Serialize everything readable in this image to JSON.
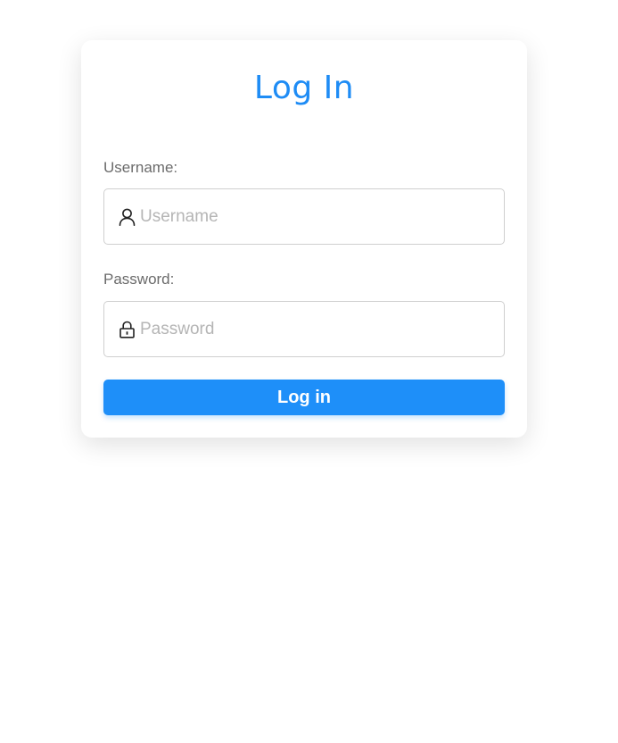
{
  "form": {
    "title": "Log In",
    "username": {
      "label": "Username:",
      "placeholder": "Username",
      "value": "",
      "icon": "user-icon"
    },
    "password": {
      "label": "Password:",
      "placeholder": "Password",
      "value": "",
      "icon": "lock-icon"
    },
    "submit_label": "Log in"
  },
  "colors": {
    "accent": "#1e8ff9",
    "title": "#1e8cf5",
    "label": "#6b6b6b",
    "placeholder": "#b5b5b5",
    "input_border": "#cfcfcf"
  }
}
